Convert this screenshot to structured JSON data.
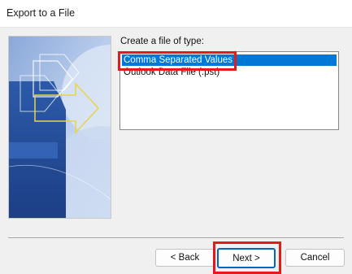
{
  "window": {
    "title": "Export to a File"
  },
  "prompt": {
    "label": "Create a file of type:"
  },
  "file_types": {
    "items": [
      {
        "label": "Comma Separated Values",
        "selected": true
      },
      {
        "label": "Outlook Data File (.pst)",
        "selected": false
      }
    ]
  },
  "buttons": {
    "back": "< Back",
    "next": "Next >",
    "cancel": "Cancel"
  },
  "colors": {
    "selection": "#0078d7",
    "annotation": "#e21b1b",
    "default_button_border": "#0067c0"
  }
}
